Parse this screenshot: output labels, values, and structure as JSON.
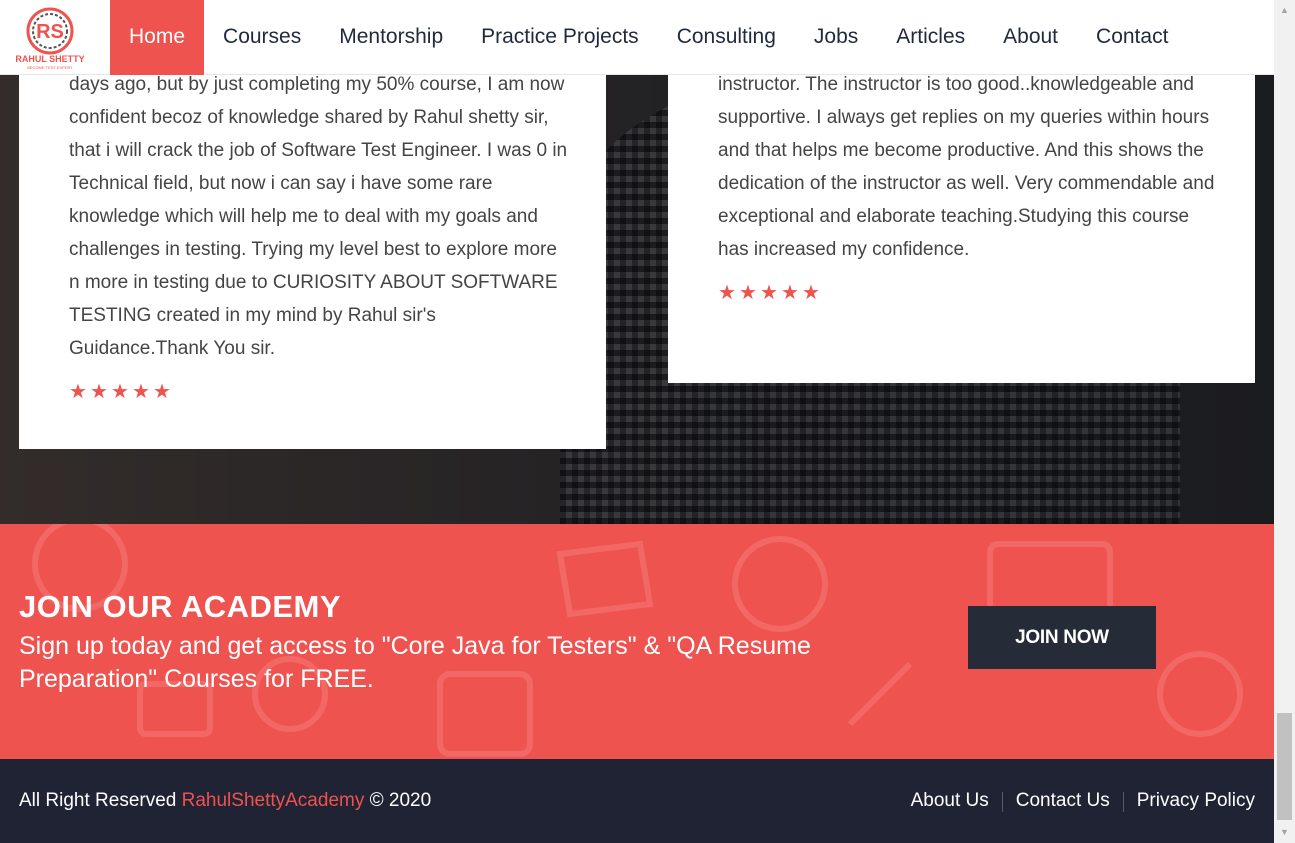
{
  "nav": {
    "logo_text": "RAHUL SHETTY",
    "logo_tagline": "BECOME TEST EXPERT",
    "items": [
      {
        "label": "Home",
        "active": true
      },
      {
        "label": "Courses"
      },
      {
        "label": "Mentorship"
      },
      {
        "label": "Practice Projects"
      },
      {
        "label": "Consulting"
      },
      {
        "label": "Jobs"
      },
      {
        "label": "Articles"
      },
      {
        "label": "About"
      },
      {
        "label": "Contact"
      }
    ]
  },
  "testimonials": [
    {
      "text": "days ago, but by just completing my 50% course, I am now confident becoz of knowledge shared by Rahul shetty sir, that i will crack the job of Software Test Engineer. I was 0 in Technical field, but now i can say i have some rare knowledge which will help me to deal with my goals and challenges in testing. Trying my level best to explore more n more in testing due to CURIOSITY ABOUT SOFTWARE TESTING created in my mind by Rahul sir's Guidance.Thank You sir.",
      "rating": 5
    },
    {
      "text": "instructor. The instructor is too good..knowledgeable and supportive. I always get replies on my queries within hours and that helps me become productive. And this shows the dedication of the instructor as well. Very commendable and exceptional and elaborate teaching.Studying this course has increased my confidence.",
      "rating": 5
    }
  ],
  "cta": {
    "heading": "JOIN OUR ACADEMY",
    "subtext": "Sign up today and get access to \"Core Java for Testers\" & \"QA Resume Preparation\" Courses for FREE.",
    "button_label": "JOIN NOW"
  },
  "footer": {
    "rights_prefix": "All Right Reserved ",
    "brand": "RahulShettyAcademy",
    "rights_suffix": " © 2020",
    "links": [
      "About Us",
      "Contact Us",
      "Privacy Policy"
    ]
  },
  "colors": {
    "accent": "#ef5350",
    "footer_bg": "#1f2333",
    "button_bg": "#262b38"
  }
}
